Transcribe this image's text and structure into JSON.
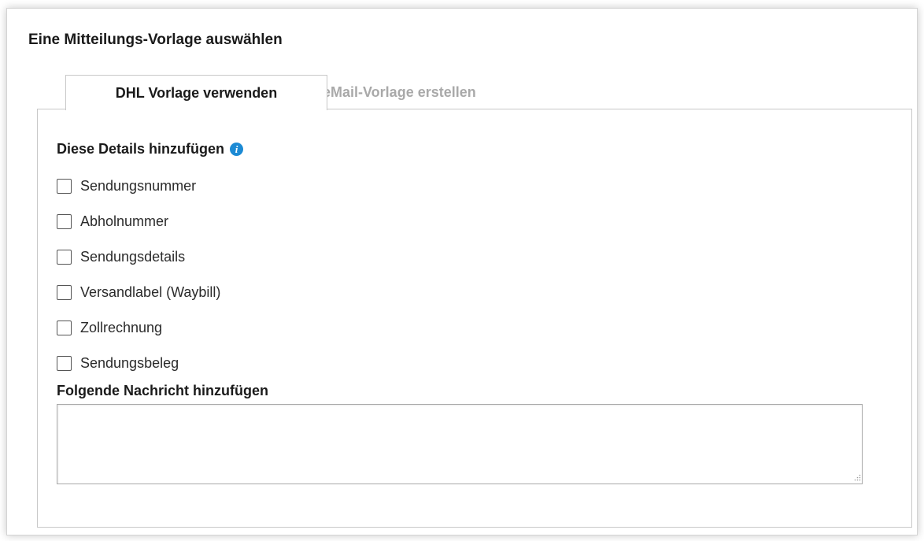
{
  "panel": {
    "title": "Eine Mitteilungs-Vorlage auswählen"
  },
  "tabs": [
    {
      "label": "DHL Vorlage verwenden",
      "active": true
    },
    {
      "label": "eMail-Vorlage erstellen",
      "active": false
    }
  ],
  "details": {
    "heading": "Diese Details hinzufügen",
    "info_icon": "info-icon",
    "info_icon_glyph": "i",
    "options": [
      {
        "label": "Sendungsnummer",
        "checked": false
      },
      {
        "label": "Abholnummer",
        "checked": false
      },
      {
        "label": "Sendungsdetails",
        "checked": false
      },
      {
        "label": "Versandlabel (Waybill)",
        "checked": false
      },
      {
        "label": "Zollrechnung",
        "checked": false
      },
      {
        "label": "Sendungsbeleg",
        "checked": false
      }
    ]
  },
  "message": {
    "heading": "Folgende Nachricht hinzufügen",
    "value": "",
    "placeholder": ""
  },
  "colors": {
    "info_icon": "#1c8ad4",
    "inactive_tab_text": "#a9a9a9",
    "border": "#c8c8c8"
  }
}
